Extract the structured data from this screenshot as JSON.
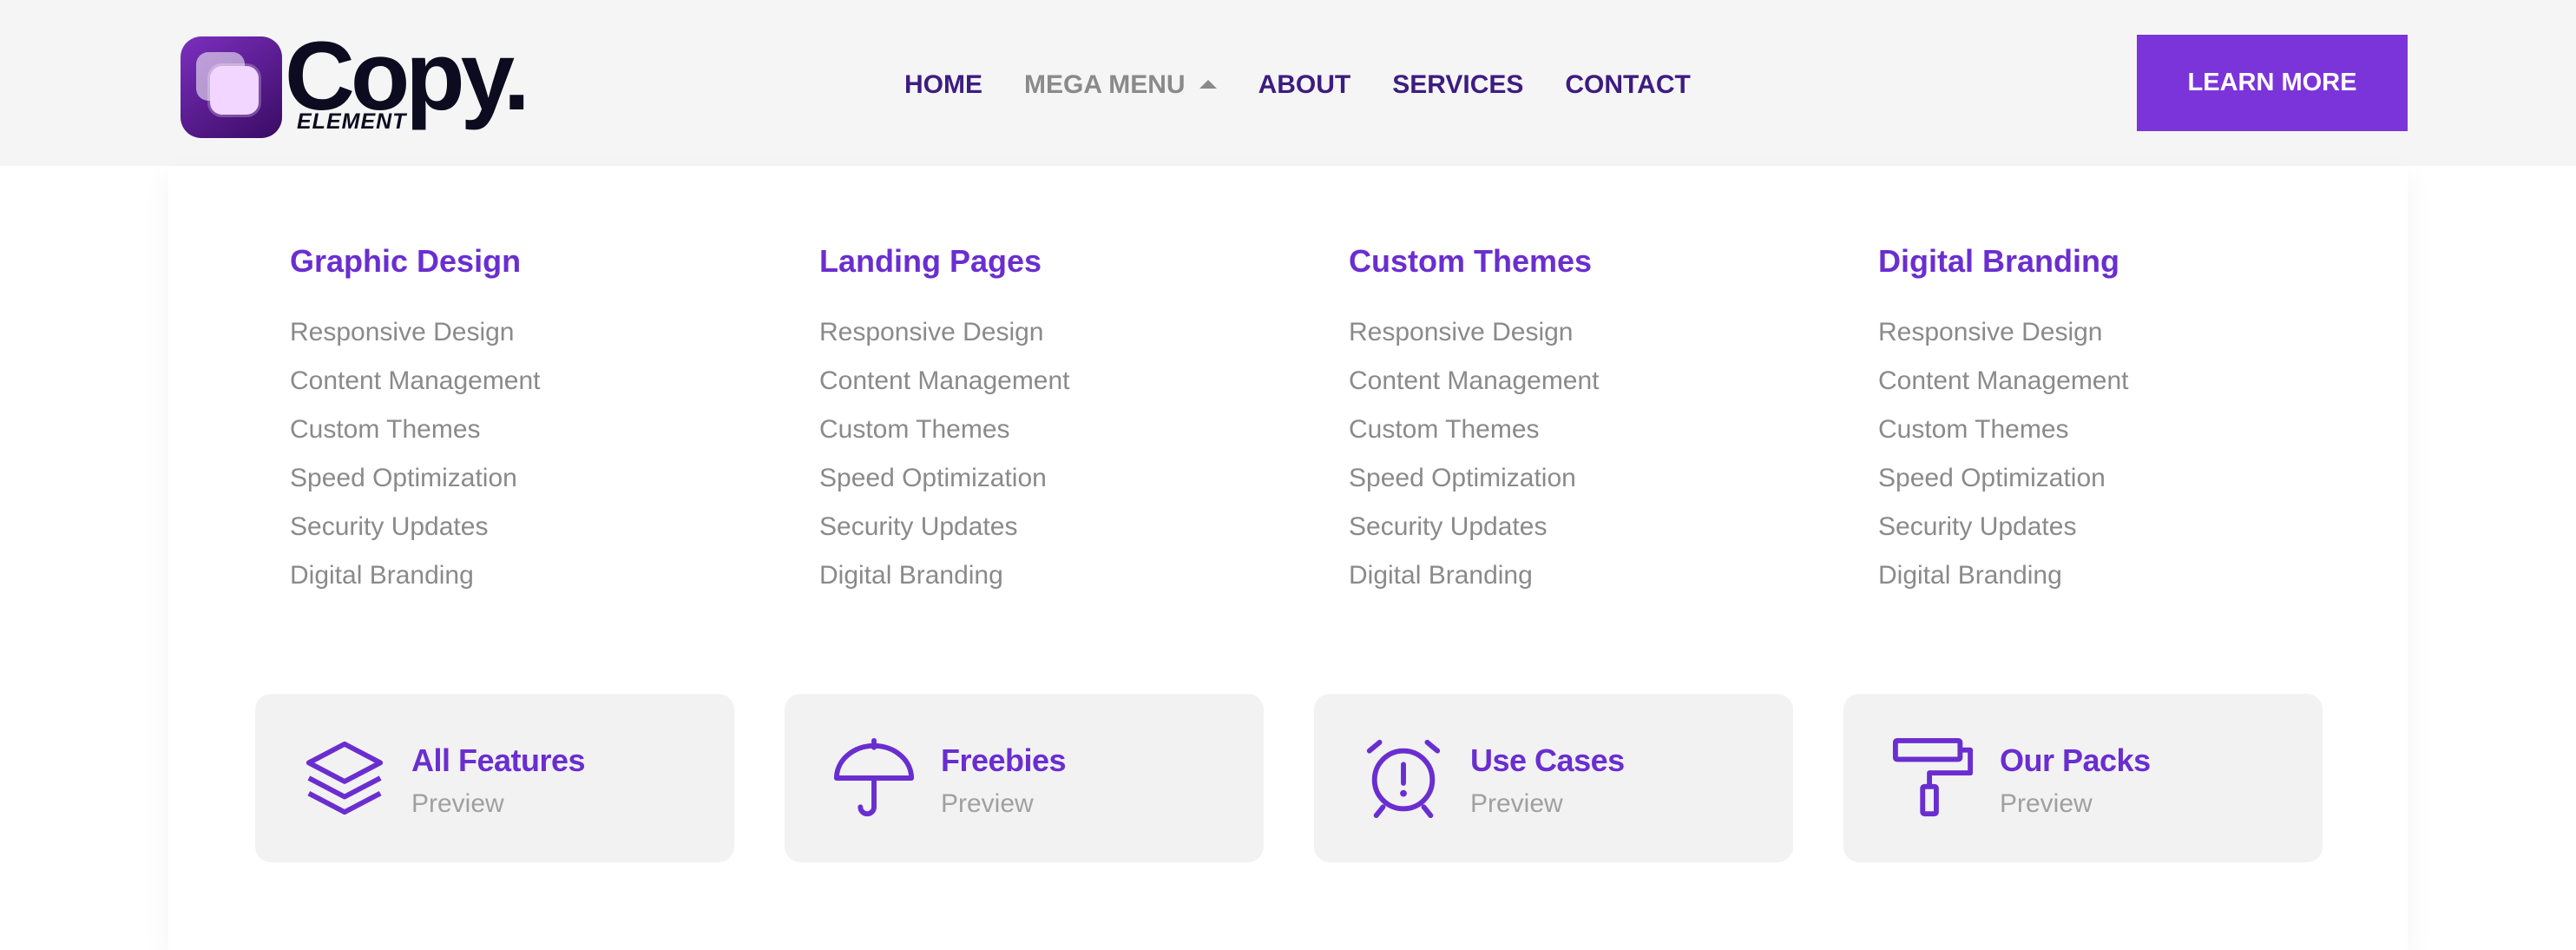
{
  "brand": {
    "name": "Copy.",
    "subtitle": "ELEMENT",
    "logo_gradient_start": "#7b2fbf",
    "logo_gradient_end": "#3a0b63"
  },
  "nav": {
    "items": [
      {
        "label": "HOME",
        "active": false
      },
      {
        "label": "MEGA MENU",
        "active": true
      },
      {
        "label": "ABOUT",
        "active": false
      },
      {
        "label": "SERVICES",
        "active": false
      },
      {
        "label": "CONTACT",
        "active": false
      }
    ]
  },
  "cta": {
    "label": "LEARN MORE",
    "color": "#7b34d9"
  },
  "colors": {
    "accent": "#6a2ed0",
    "nav_text": "#3d1c80",
    "muted": "#8a8a8a"
  },
  "mega_menu": {
    "columns": [
      {
        "title": "Graphic Design",
        "links": [
          "Responsive Design",
          "Content Management",
          "Custom Themes",
          "Speed Optimization",
          "Security Updates",
          "Digital Branding"
        ]
      },
      {
        "title": "Landing Pages",
        "links": [
          "Responsive Design",
          "Content Management",
          "Custom Themes",
          "Speed Optimization",
          "Security Updates",
          "Digital Branding"
        ]
      },
      {
        "title": "Custom Themes",
        "links": [
          "Responsive Design",
          "Content Management",
          "Custom Themes",
          "Speed Optimization",
          "Security Updates",
          "Digital Branding"
        ]
      },
      {
        "title": "Digital Branding",
        "links": [
          "Responsive Design",
          "Content Management",
          "Custom Themes",
          "Speed Optimization",
          "Security Updates",
          "Digital Branding"
        ]
      }
    ],
    "cards": [
      {
        "title": "All Features",
        "subtitle": "Preview",
        "icon": "layers-icon"
      },
      {
        "title": "Freebies",
        "subtitle": "Preview",
        "icon": "umbrella-icon"
      },
      {
        "title": "Use Cases",
        "subtitle": "Preview",
        "icon": "alarm-clock-icon"
      },
      {
        "title": "Our Packs",
        "subtitle": "Preview",
        "icon": "paint-roller-icon"
      }
    ]
  }
}
